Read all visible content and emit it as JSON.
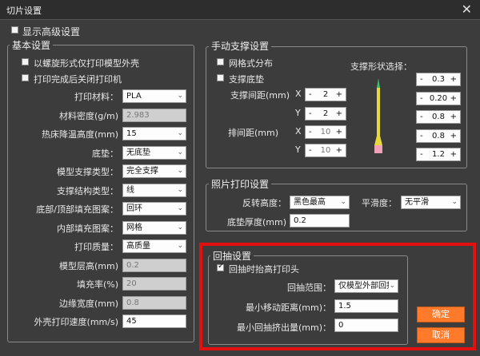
{
  "window": {
    "title": "切片设置"
  },
  "show_advanced": {
    "label": "显示高级设置",
    "checked": false
  },
  "basic": {
    "title": "基本设置",
    "spiral": {
      "label": "以螺旋形式仅打印模型外壳",
      "checked": false
    },
    "close_after": {
      "label": "打印完成后关闭打印机",
      "checked": false
    },
    "rows": [
      {
        "label": "打印材料：",
        "kind": "select",
        "value": "PLA"
      },
      {
        "label": "材料密度(g/m)",
        "kind": "input",
        "value": "2.983",
        "disabled": true
      },
      {
        "label": "热床降温高度(mm)",
        "kind": "select",
        "value": "15"
      },
      {
        "label": "底垫：",
        "kind": "select",
        "value": "无底垫"
      },
      {
        "label": "模型支撑类型：",
        "kind": "select",
        "value": "完全支撑"
      },
      {
        "label": "支撑结构类型：",
        "kind": "select",
        "value": "线"
      },
      {
        "label": "底部/顶部填充图案：",
        "kind": "select",
        "value": "回环"
      },
      {
        "label": "内部填充图案：",
        "kind": "select",
        "value": "网格"
      },
      {
        "label": "打印质量：",
        "kind": "select",
        "value": "高质量"
      },
      {
        "label": "模型层高(mm)",
        "kind": "input",
        "value": "0.2",
        "disabled": true
      },
      {
        "label": "填充率(%)",
        "kind": "input",
        "value": "20",
        "disabled": true
      },
      {
        "label": "边缘宽度(mm)",
        "kind": "input",
        "value": "0.8",
        "disabled": true
      },
      {
        "label": "外壳打印速度(mm/s)",
        "kind": "input",
        "value": "45",
        "disabled": false
      }
    ]
  },
  "manual": {
    "title": "手动支撑设置",
    "grid": {
      "label": "网格式分布",
      "checked": false
    },
    "base": {
      "label": "支撑底垫",
      "checked": false
    },
    "spacing_label": "支撑间距(mm)",
    "spacing_x": {
      "axis": "X",
      "value": "2"
    },
    "spacing_y": {
      "axis": "Y",
      "value": "2"
    },
    "row_label": "排间距(mm)",
    "row_x": {
      "axis": "X",
      "value": "10"
    },
    "row_y": {
      "axis": "Y",
      "value": "10"
    },
    "shape_label": "支撑形状选择：",
    "shape_values": [
      "0.3",
      "0.20",
      "0.8",
      "0.8",
      "1.2"
    ],
    "spin_minus": "-",
    "spin_plus": "+"
  },
  "photo": {
    "title": "照片打印设置",
    "reverse_label": "反转高度：",
    "reverse_value": "黑色最高",
    "smooth_label": "平滑度：",
    "smooth_value": "无平滑",
    "thickness_label": "底垫厚度(mm)",
    "thickness_value": "0.2"
  },
  "retract": {
    "title": "回抽设置",
    "lift": {
      "label": "回抽时抬高打印头",
      "checked": true
    },
    "range_label": "回抽范围：",
    "range_value": "仅模型外部回抽",
    "min_move_label": "最小移动距离(mm)：",
    "min_move_value": "1.5",
    "min_extrude_label": "最小回抽挤出量(mm)：",
    "min_extrude_value": "0"
  },
  "buttons": {
    "ok": "确定",
    "cancel": "取消"
  },
  "colors": {
    "accent": "#ff7a2a",
    "highlight": "#e41010",
    "background": "#3c3c3c"
  }
}
